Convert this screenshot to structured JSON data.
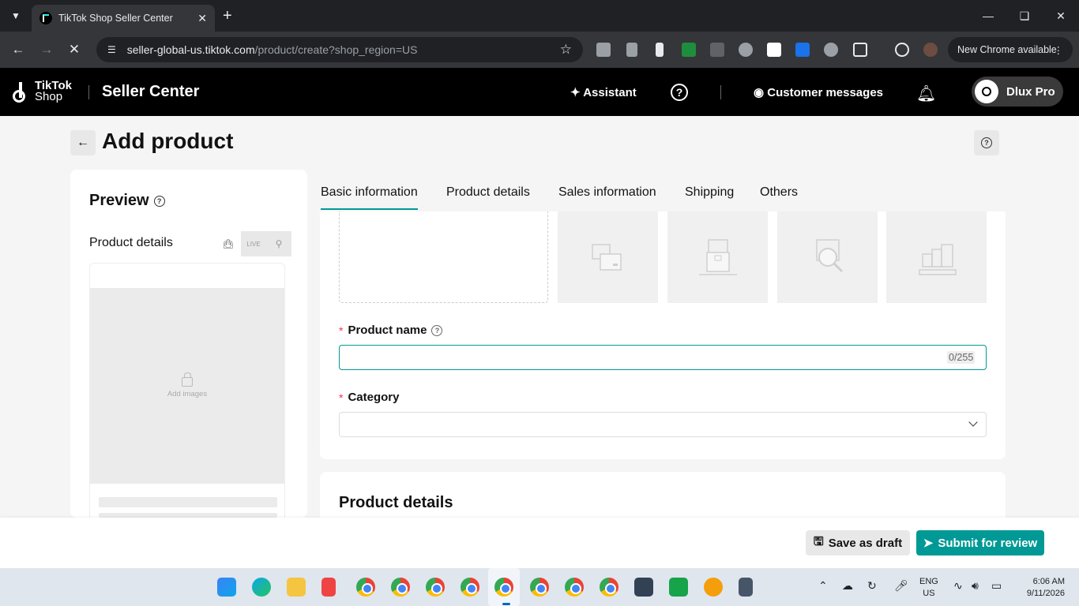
{
  "browser": {
    "tab_title": "TikTok Shop Seller Center",
    "url_host": "seller-global-us.tiktok.com",
    "url_path": "/product/create?shop_region=US",
    "update_label": "New Chrome available"
  },
  "header": {
    "logo_top": "TikTok",
    "logo_bottom": "Shop",
    "app_name": "Seller Center",
    "assistant": "Assistant",
    "customer_messages": "Customer messages",
    "profile_name": "Dlux Pro"
  },
  "page": {
    "title": "Add product"
  },
  "preview": {
    "title": "Preview",
    "subtitle": "Product details",
    "add_images": "Add images",
    "live_icon_text": "LIVE"
  },
  "tabs": [
    {
      "label": "Basic information",
      "active": true
    },
    {
      "label": "Product details",
      "active": false
    },
    {
      "label": "Sales information",
      "active": false
    },
    {
      "label": "Shipping",
      "active": false
    },
    {
      "label": "Others",
      "active": false
    }
  ],
  "form": {
    "product_name_label": "Product name",
    "product_name_value": "",
    "product_name_counter": "0/255",
    "category_label": "Category",
    "category_value": "",
    "required_mark": "*"
  },
  "details_section": {
    "title": "Product details"
  },
  "footer": {
    "save_draft": "Save as draft",
    "submit": "Submit for review"
  },
  "taskbar": {
    "lang_top": "ENG",
    "lang_bottom": "US",
    "time": "6:06 AM",
    "date": "9/11/2026"
  },
  "colors": {
    "accent": "#009995",
    "required": "#fe2c55"
  }
}
